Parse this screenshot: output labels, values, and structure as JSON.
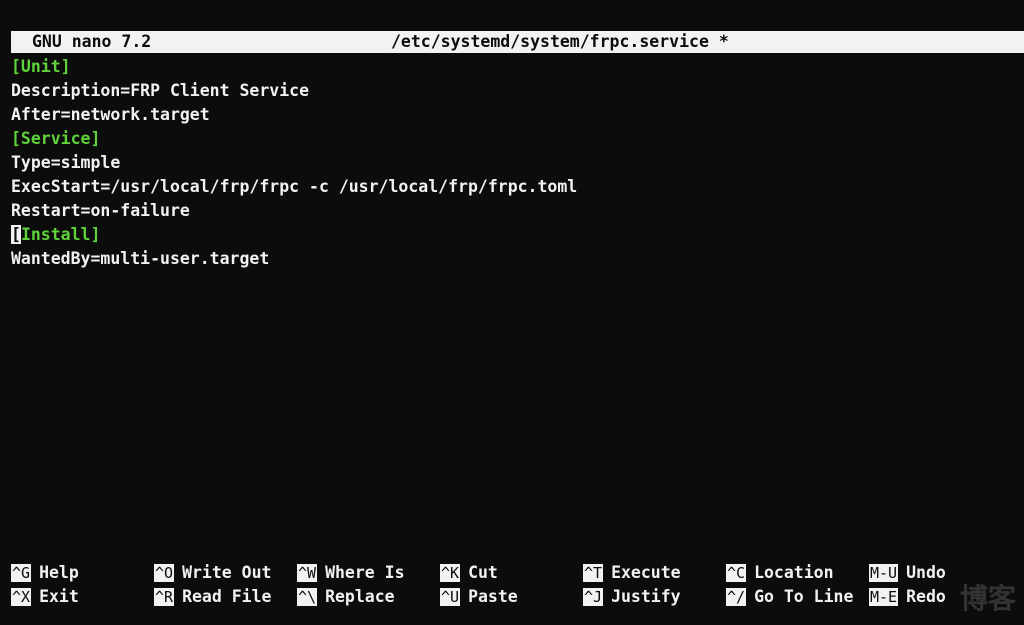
{
  "title_bar": {
    "app": "GNU nano 7.2",
    "file": "/etc/systemd/system/frpc.service *"
  },
  "editor": {
    "lines": [
      "[Unit]",
      "Description=FRP Client Service",
      "After=network.target",
      "[Service]",
      "Type=simple",
      "ExecStart=/usr/local/frp/frpc -c /usr/local/frp/frpc.toml",
      "Restart=on-failure",
      "[",
      "Install]",
      "WantedBy=multi-user.target"
    ]
  },
  "shortcuts": [
    {
      "key": "^G",
      "label": "Help"
    },
    {
      "key": "^O",
      "label": "Write Out"
    },
    {
      "key": "^W",
      "label": "Where Is"
    },
    {
      "key": "^K",
      "label": "Cut"
    },
    {
      "key": "^T",
      "label": "Execute"
    },
    {
      "key": "^C",
      "label": "Location"
    },
    {
      "key": "M-U",
      "label": "Undo"
    },
    {
      "key": "^X",
      "label": "Exit"
    },
    {
      "key": "^R",
      "label": "Read File"
    },
    {
      "key": "^\\",
      "label": "Replace"
    },
    {
      "key": "^U",
      "label": "Paste"
    },
    {
      "key": "^J",
      "label": "Justify"
    },
    {
      "key": "^/",
      "label": "Go To Line"
    },
    {
      "key": "M-E",
      "label": "Redo"
    }
  ],
  "watermark": "博客",
  "colors": {
    "background": "#0c0c0c",
    "foreground": "#f2f2f2",
    "section_header": "#5fd13a"
  }
}
